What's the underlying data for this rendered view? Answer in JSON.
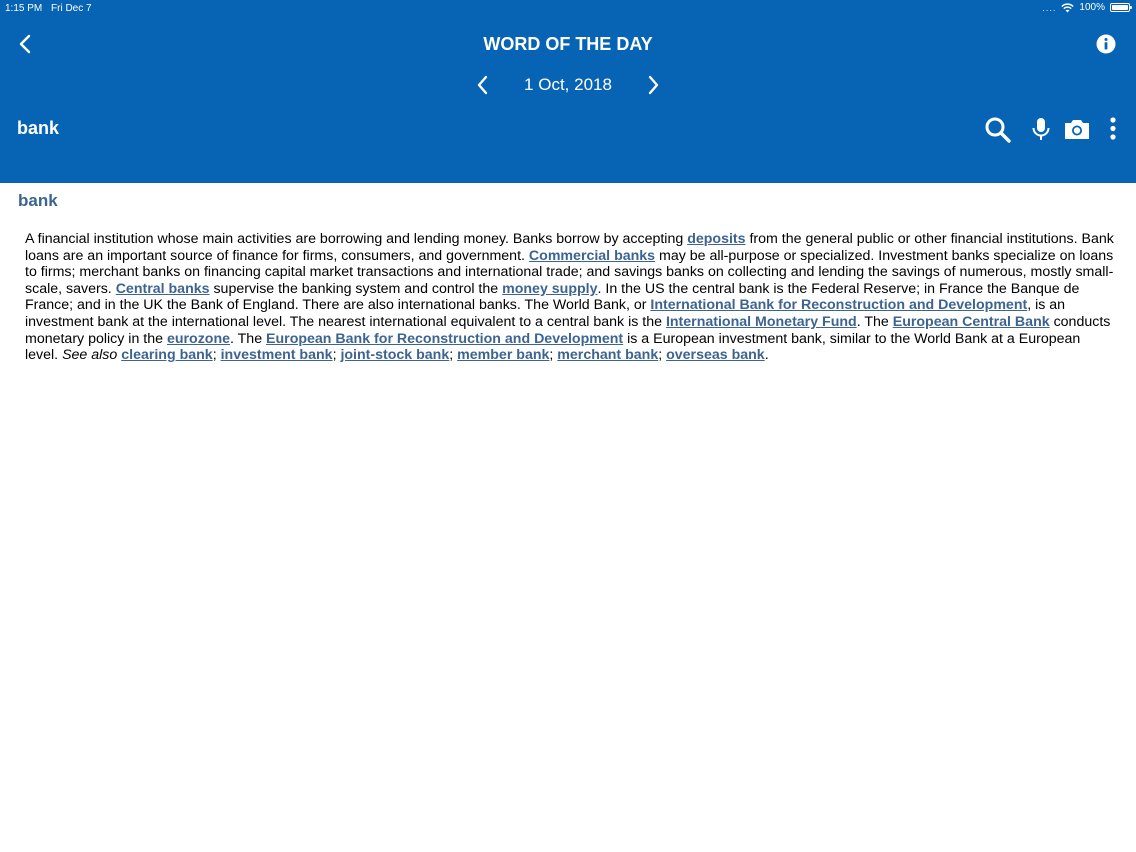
{
  "status_bar": {
    "time": "1:15 PM",
    "date": "Fri Dec 7",
    "signal": "....",
    "battery": "100%"
  },
  "header": {
    "title": "WORD OF THE DAY",
    "date": "1 Oct, 2018",
    "search_value": "bank",
    "icons": [
      "back-icon",
      "info-icon",
      "chevron-left-icon",
      "chevron-right-icon",
      "search-icon",
      "microphone-icon",
      "camera-icon",
      "more-vertical-icon"
    ]
  },
  "entry": {
    "headword": "bank",
    "definition": {
      "t1": "A financial institution whose main activities are borrowing and lending money. Banks borrow by accepting ",
      "l_deposits": "deposits",
      "t2": " from the general public or other financial institutions. Bank loans are an important source of finance for firms, consumers, and government. ",
      "l_commercial": "Commercial banks",
      "t3": " may be all-purpose or specialized. Investment banks specialize on loans to firms; merchant banks on financing capital market transactions and international trade; and savings banks on collecting and lending the savings of numerous, mostly small-scale, savers. ",
      "l_central": "Central banks",
      "t4": " supervise the banking system and control the ",
      "l_money_supply": "money supply",
      "t5": ". In the US the central bank is the Federal Reserve; in France the Banque de France; and in the UK the Bank of England. There are also international banks. The World Bank, or ",
      "l_ibrd": "International Bank for Reconstruction and Development",
      "t6": ", is an investment bank at the international level. The nearest international equivalent to a central bank is the ",
      "l_imf": "International Monetary Fund",
      "t7": ". The ",
      "l_ecb": "European Central Bank",
      "t8": " conducts monetary policy in the ",
      "l_eurozone": "eurozone",
      "t9": ". The ",
      "l_ebrd": "European Bank for Reconstruction and Development",
      "t10": " is a European investment bank, similar to the World Bank at a European level. ",
      "see_also": "See also",
      "t11": " ",
      "l_clearing": "clearing bank",
      "sep1": "; ",
      "l_investment": "investment bank",
      "sep2": "; ",
      "l_joint_stock": "joint-stock bank",
      "sep3": "; ",
      "l_member": "member bank",
      "sep4": "; ",
      "l_merchant": "merchant bank",
      "sep5": "; ",
      "l_overseas": "overseas bank",
      "end": "."
    }
  },
  "colors": {
    "header_bg": "#0764b4",
    "link": "#3d6491",
    "headword": "#3d6491"
  }
}
